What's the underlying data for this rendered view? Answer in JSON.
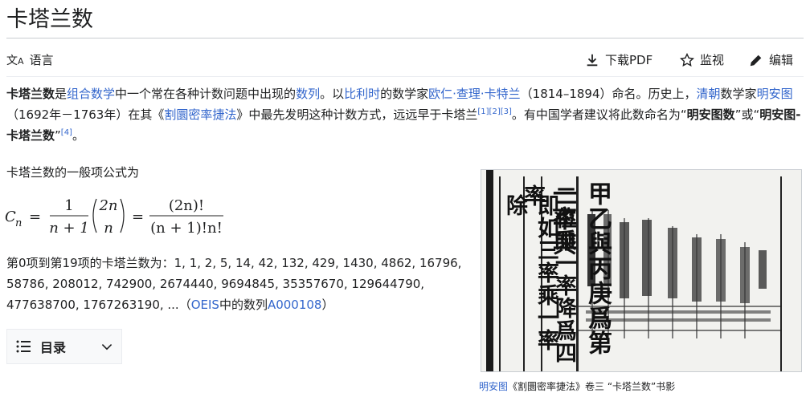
{
  "page": {
    "title": "卡塔兰数"
  },
  "toolbar": {
    "language_label": "语言",
    "download_label": "下载PDF",
    "watch_label": "监视",
    "edit_label": "编辑"
  },
  "intro": {
    "term": "卡塔兰数",
    "t1": "是",
    "link_combinatorics": "组合数学",
    "t2": "中一个常在各种计数问题中出现的",
    "link_sequence": "数列",
    "t3": "。以",
    "link_belgium": "比利时",
    "t4": "的数学家",
    "link_catalan": "欧仁·查理·卡特兰",
    "t5": "（1814–1894）命名。历史上，",
    "link_qing": "清朝",
    "t6": "数学家",
    "link_minggatu": "明安图",
    "t7": "（1692年－1763年）在其《",
    "link_book": "割圜密率捷法",
    "t8": "》中最先发明这种计数方式，远远早于卡塔兰",
    "ref1": "[1][2][3]",
    "t9": "。有中国学者建议将此数命名为“",
    "bold1": "明安图数",
    "t10": "”或“",
    "bold2": "明安图-卡塔兰数",
    "t11": "”",
    "ref2": "[4]",
    "t12": "。"
  },
  "general_formula_intro": "卡塔兰数的一般项公式为",
  "formula": {
    "lhs": "C",
    "sub": "n",
    "eq": "=",
    "one": "1",
    "denom1": "n + 1",
    "binom_top": "2n",
    "binom_bottom": "n",
    "eq2": "=",
    "frac_top": "(2n)!",
    "frac_bottom": "(n + 1)!n!"
  },
  "sequence": {
    "line1": "第0项到第19项的卡塔兰数为：1, 1, 2, 5, 14, 42, 132, 429, 1430, 4862, 16796,",
    "line2": "58786, 208012, 742900, 2674440, 9694845, 35357670, 129644790,",
    "line3a": "477638700, 1767263190, ...（",
    "link_oeis": "OEIS",
    "line3b": "中的数列",
    "link_a": "A000108",
    "line3c": "）"
  },
  "toc": {
    "label": "目录"
  },
  "figure": {
    "caption_link": "明安图",
    "caption_text": "《割圜密率捷法》卷三 “卡塔兰数”书影",
    "cols": [
      "甲乙與丙庚爲第一率與",
      "二位乘一率降爲四率",
      "即如三率乘一率除"
    ]
  },
  "colors": {
    "link": "#3366cc",
    "text": "#202122",
    "border": "#c8ccd1"
  }
}
